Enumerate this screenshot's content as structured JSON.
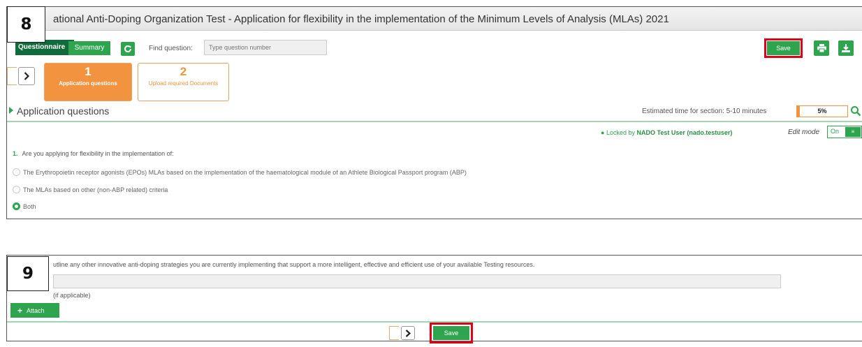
{
  "step_badges": {
    "first": "8",
    "second": "9"
  },
  "window": {
    "title": "ational Anti-Doping Organization Test - Application for flexibility in the implementation of the Minimum Levels of Analysis (MLAs) 2021"
  },
  "toolbar": {
    "questionnaire_label": "Questionnaire",
    "summary_label": "Summary",
    "refresh_icon": "refresh-icon",
    "find_label": "Find question:",
    "find_placeholder": "Type question number",
    "save_label": "Save",
    "print_icon": "print-icon",
    "download_icon": "download-icon"
  },
  "steps": [
    {
      "number": "1",
      "label": "Application questions",
      "active": true
    },
    {
      "number": "2",
      "label": "Upload required Documents",
      "active": false
    }
  ],
  "section": {
    "title": "Application questions",
    "estimated_label": "Estimated time for section: 5-10 minutes",
    "progress_text": "5%",
    "progress_fraction": 0.05
  },
  "lock": {
    "prefix": "Locked by",
    "user": "NADO Test User (nado.testuser)",
    "edit_mode_label": "Edit mode",
    "toggle_text": "On"
  },
  "question1": {
    "number": "1.",
    "text": "Are you applying for flexibility in the implementation of:",
    "options": [
      {
        "label": "The Erythropoietin receptor agonists (EPOs) MLAs based on the implementation of the haematological module of an Athlete Biological Passport program (ABP)",
        "checked": false
      },
      {
        "label": "The MLAs based on other (non-ABP related) criteria",
        "checked": false
      },
      {
        "label": "Both",
        "checked": true
      }
    ]
  },
  "panel2": {
    "question_text": "utline any other  innovative anti-doping strategies you are currently implementing that support a more intelligent, effective and efficient use of your available Testing resources.",
    "attach_note": "(if applicable)",
    "attach_label": "Attach",
    "save_label": "Save"
  },
  "colors": {
    "brand_green": "#2ea44f",
    "dark_green": "#0f6b3a",
    "accent_orange": "#f2933f",
    "highlight_red": "#e0001a"
  }
}
